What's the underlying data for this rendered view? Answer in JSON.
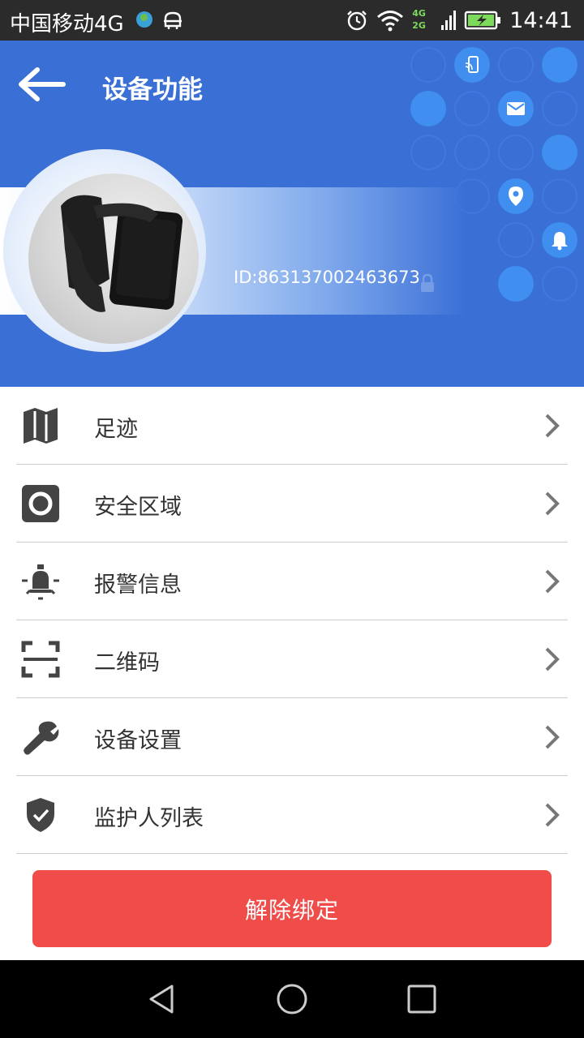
{
  "status_bar": {
    "carrier": "中国移动4G",
    "network_label_top": "4G",
    "network_label_bottom": "2G",
    "time": "14:41"
  },
  "header": {
    "title": "设备功能",
    "device_id": "ID:863137002463673",
    "accent_color": "#3a6fd6"
  },
  "menu": {
    "items": [
      {
        "label": "足迹",
        "icon": "map-icon"
      },
      {
        "label": "安全区域",
        "icon": "safe-zone-icon"
      },
      {
        "label": "报警信息",
        "icon": "alarm-light-icon"
      },
      {
        "label": "二维码",
        "icon": "qr-scan-icon"
      },
      {
        "label": "设备设置",
        "icon": "wrench-icon"
      },
      {
        "label": "监护人列表",
        "icon": "shield-check-icon"
      }
    ]
  },
  "unbind_button": {
    "label": "解除绑定",
    "color": "#ef4c4a"
  }
}
